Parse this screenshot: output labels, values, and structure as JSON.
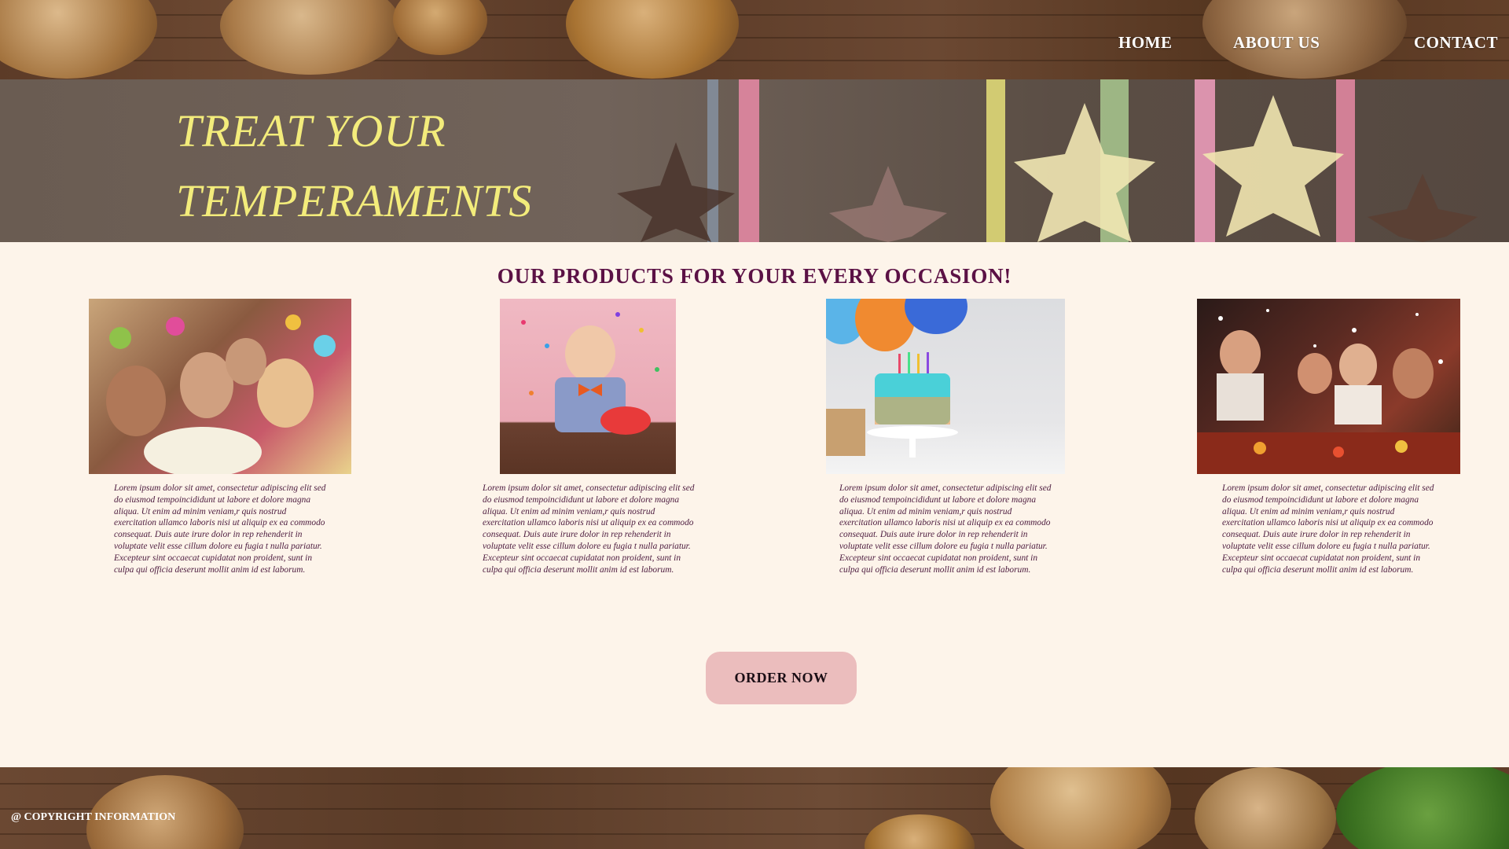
{
  "nav": {
    "home": "HOME",
    "about": "ABOUT US",
    "contact": "CONTACT"
  },
  "hero": {
    "line1": "TREAT YOUR",
    "line2": "TEMPERAMENTS"
  },
  "products": {
    "title": "OUR PRODUCTS FOR YOUR EVERY OCCASION!",
    "cards": [
      {
        "image": "party-celebration-photo",
        "text": "Lorem ipsum dolor sit amet, consectetur adipiscing elit  sed do eiusmod tempoincididunt ut labore et dolore magna aliqua. Ut enim ad minim veniam,r  quis nostrud  exercitation ullamco laboris nisi ut aliquip ex ea  commodo consequat. Duis aute irure dolor in rep rehenderit in voluptate velit esse cillum dolore eu fugia t nulla pariatur. Excepteur sint occaecat cupidatat non  proident, sunt in culpa qui officia deserunt mollit anim  id est laborum."
      },
      {
        "image": "boy-birthday-cake-photo",
        "text": "Lorem ipsum dolor sit amet, consectetur adipiscing elit  sed do eiusmod tempoincididunt ut labore et dolore magna aliqua. Ut enim ad minim veniam,r  quis nostrud  exercitation ullamco laboris nisi ut aliquip ex ea  commodo consequat. Duis aute irure dolor in rep rehenderit in voluptate velit esse cillum dolore eu fugia t nulla pariatur. Excepteur sint occaecat cupidatat non  proident, sunt in culpa qui officia deserunt mollit anim  id est laborum."
      },
      {
        "image": "birthday-cake-balloons-photo",
        "text": "Lorem ipsum dolor sit amet, consectetur adipiscing elit  sed do eiusmod tempoincididunt ut labore et dolore magna aliqua. Ut enim ad minim veniam,r  quis nostrud  exercitation ullamco laboris nisi ut aliquip ex ea  commodo consequat. Duis aute irure dolor in rep rehenderit in voluptate velit esse cillum dolore eu fugia t nulla pariatur. Excepteur sint occaecat cupidatat non  proident, sunt in culpa qui officia deserunt mollit anim  id est laborum."
      },
      {
        "image": "christmas-dinner-photo",
        "text": "Lorem ipsum dolor sit amet, consectetur adipiscing elit  sed do eiusmod tempoincididunt ut labore et dolore magna aliqua. Ut enim ad minim veniam,r  quis nostrud  exercitation ullamco laboris nisi ut aliquip ex ea  commodo consequat. Duis aute irure dolor in rep rehenderit in voluptate velit esse cillum dolore eu fugia t nulla pariatur. Excepteur sint occaecat cupidatat non  proident, sunt in culpa qui officia deserunt mollit anim  id est laborum."
      }
    ]
  },
  "cta": {
    "order_label": "ORDER NOW"
  },
  "footer": {
    "copyright": "@ COPYRIGHT INFORMATION"
  },
  "colors": {
    "background": "#fdf4ea",
    "hero_title": "#f3ec7b",
    "section_title": "#5b1145",
    "button": "#ebbdbd"
  }
}
